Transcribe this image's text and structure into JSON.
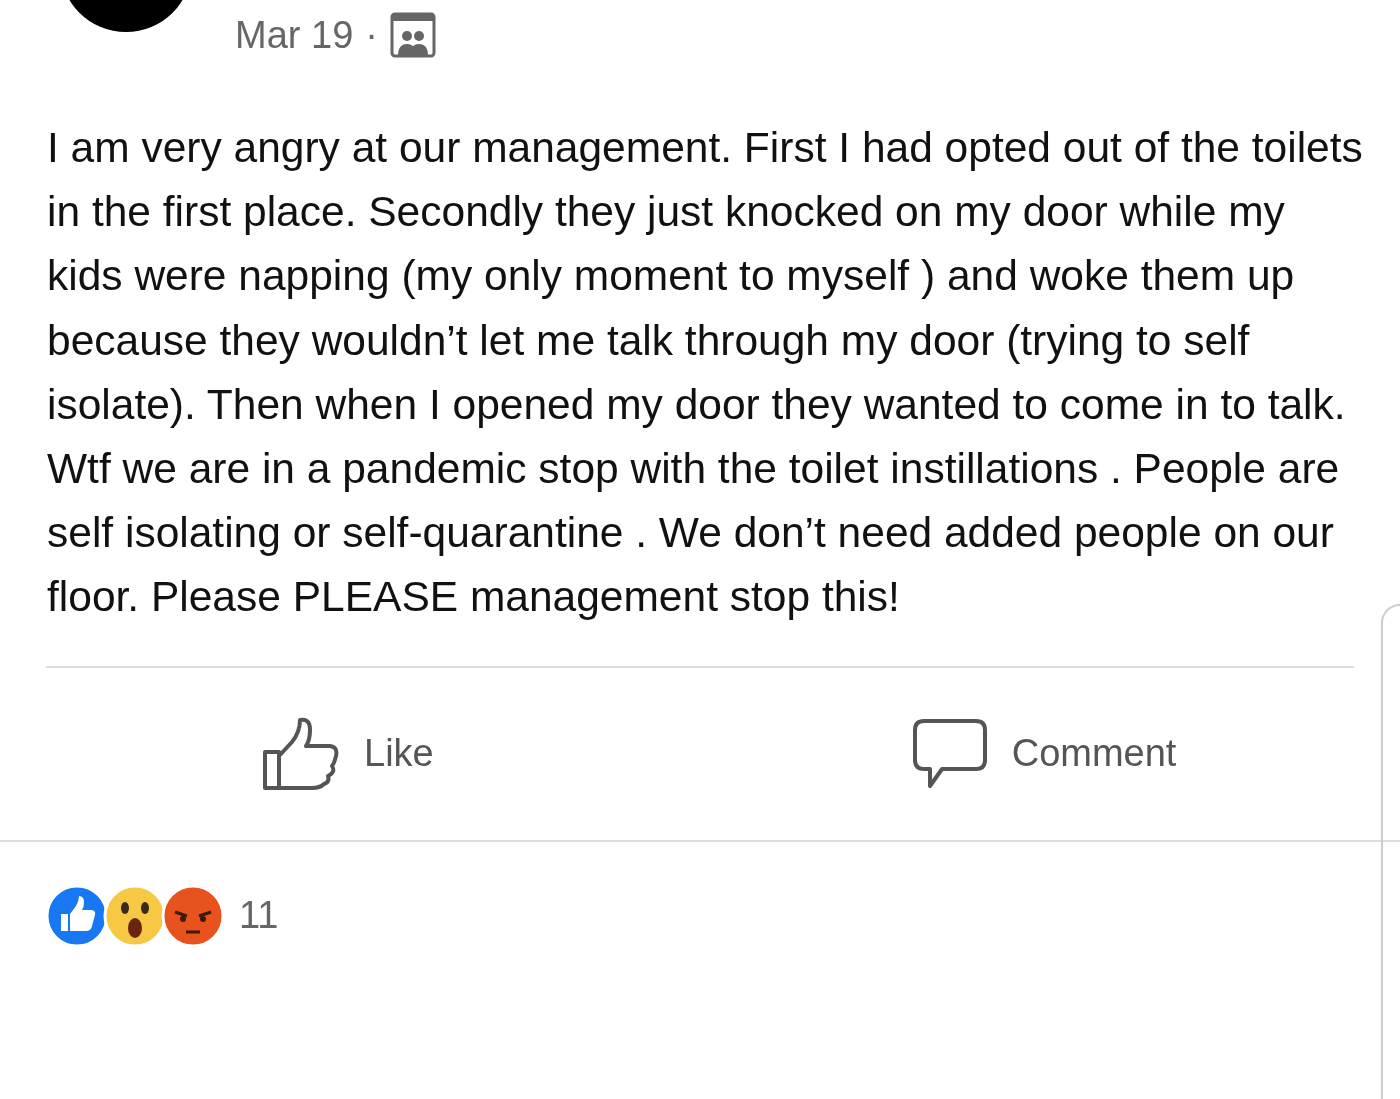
{
  "post": {
    "date": "Mar 19",
    "separator": "·",
    "text": "I am very angry at our management. First I had opted out of the toilets in the first place. Secondly they just knocked on my door while my kids were napping (my only moment to myself ) and woke them up because they wouldn’t let me talk through my door (trying to self isolate). Then when I opened my door they wanted to come in to talk. Wtf we are in a pandemic stop with the toilet instillations . People are self isolating or self-quarantine . We don’t need added people on our floor. Please PLEASE management stop this!",
    "actions": [
      {
        "kind": "like",
        "label": "Like"
      },
      {
        "kind": "comment",
        "label": "Comment"
      }
    ],
    "reactions": {
      "types": [
        {
          "kind": "like"
        },
        {
          "kind": "wow"
        },
        {
          "kind": "angry"
        }
      ],
      "count": "11"
    }
  }
}
